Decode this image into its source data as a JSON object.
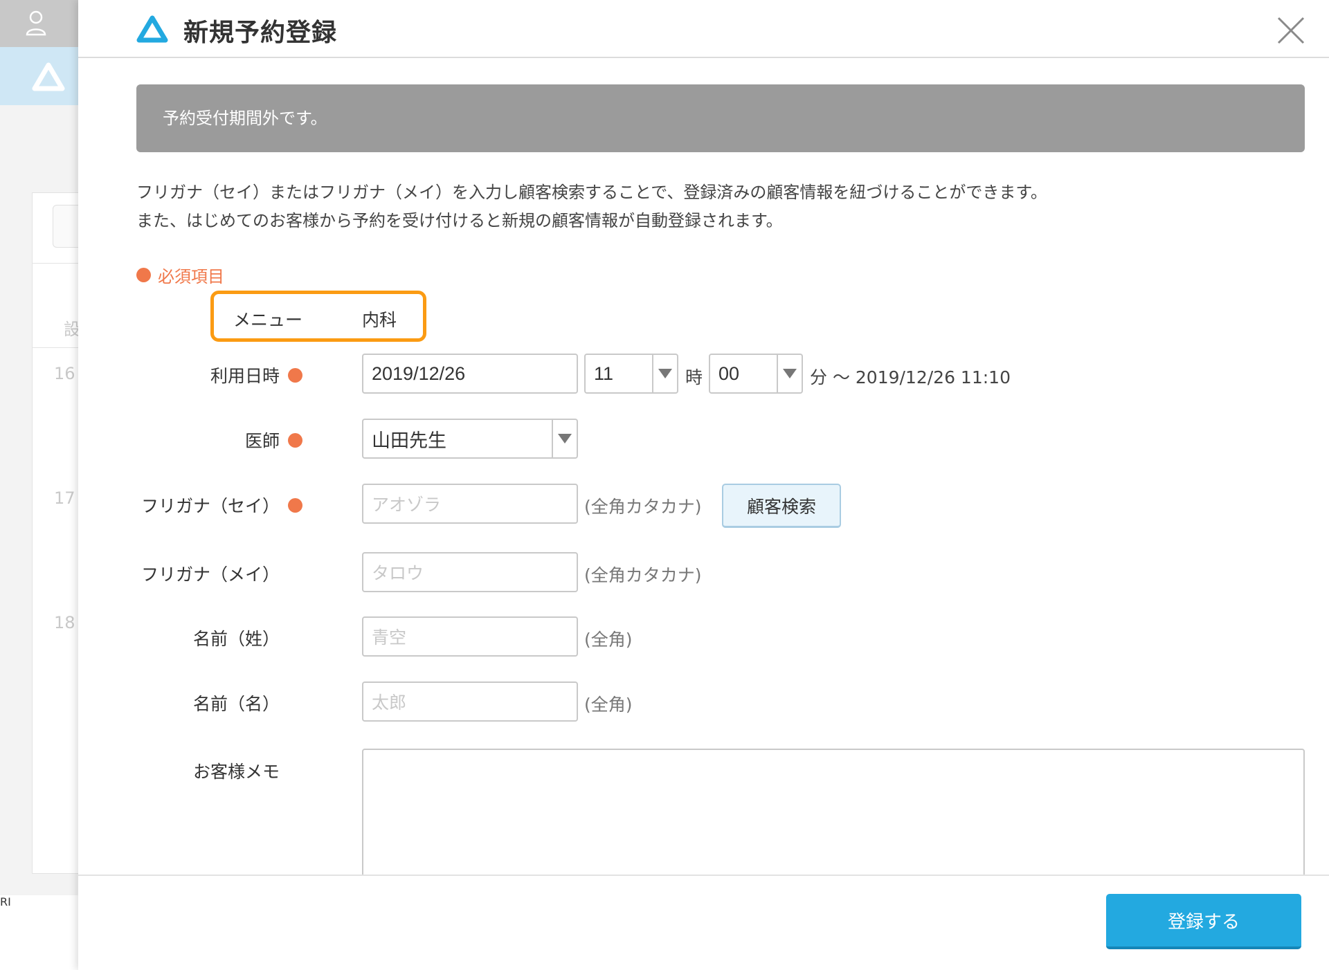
{
  "modal": {
    "title": "新規予約登録",
    "notice": "予約受付期間外です。",
    "description_line1": "フリガナ（セイ）またはフリガナ（メイ）を入力し顧客検索することで、登録済みの顧客情報を紐づけることができます。",
    "description_line2": "また、はじめてのお客様から予約を受け付けると新規の顧客情報が自動登録されます。",
    "required_note": "必須項目"
  },
  "menu": {
    "label": "メニュー",
    "value": "内科"
  },
  "datetime": {
    "label": "利用日時",
    "date_value": "2019/12/26",
    "hour_value": "11",
    "hour_unit": "時",
    "minute_value": "00",
    "range_text": "分 〜 2019/12/26 11:10"
  },
  "doctor": {
    "label": "医師",
    "value": "山田先生"
  },
  "kana_sei": {
    "label": "フリガナ（セイ）",
    "placeholder": "アオゾラ",
    "hint": "(全角カタカナ)",
    "search_button": "顧客検索"
  },
  "kana_mei": {
    "label": "フリガナ（メイ）",
    "placeholder": "タロウ",
    "hint": "(全角カタカナ)"
  },
  "last_name": {
    "label": "名前（姓）",
    "placeholder": "青空",
    "hint": "(全角)"
  },
  "first_name": {
    "label": "名前（名）",
    "placeholder": "太郎",
    "hint": "(全角)"
  },
  "memo": {
    "label": "お客様メモ"
  },
  "footer": {
    "submit_label": "登録する"
  },
  "background": {
    "labels": [
      "設",
      "16",
      "17",
      "18"
    ],
    "logo_text": "RI"
  },
  "colors": {
    "accent": "#23a9e0",
    "required": "#f0784a",
    "highlight": "#fb9b13",
    "notice_bg": "#9b9b9b"
  }
}
